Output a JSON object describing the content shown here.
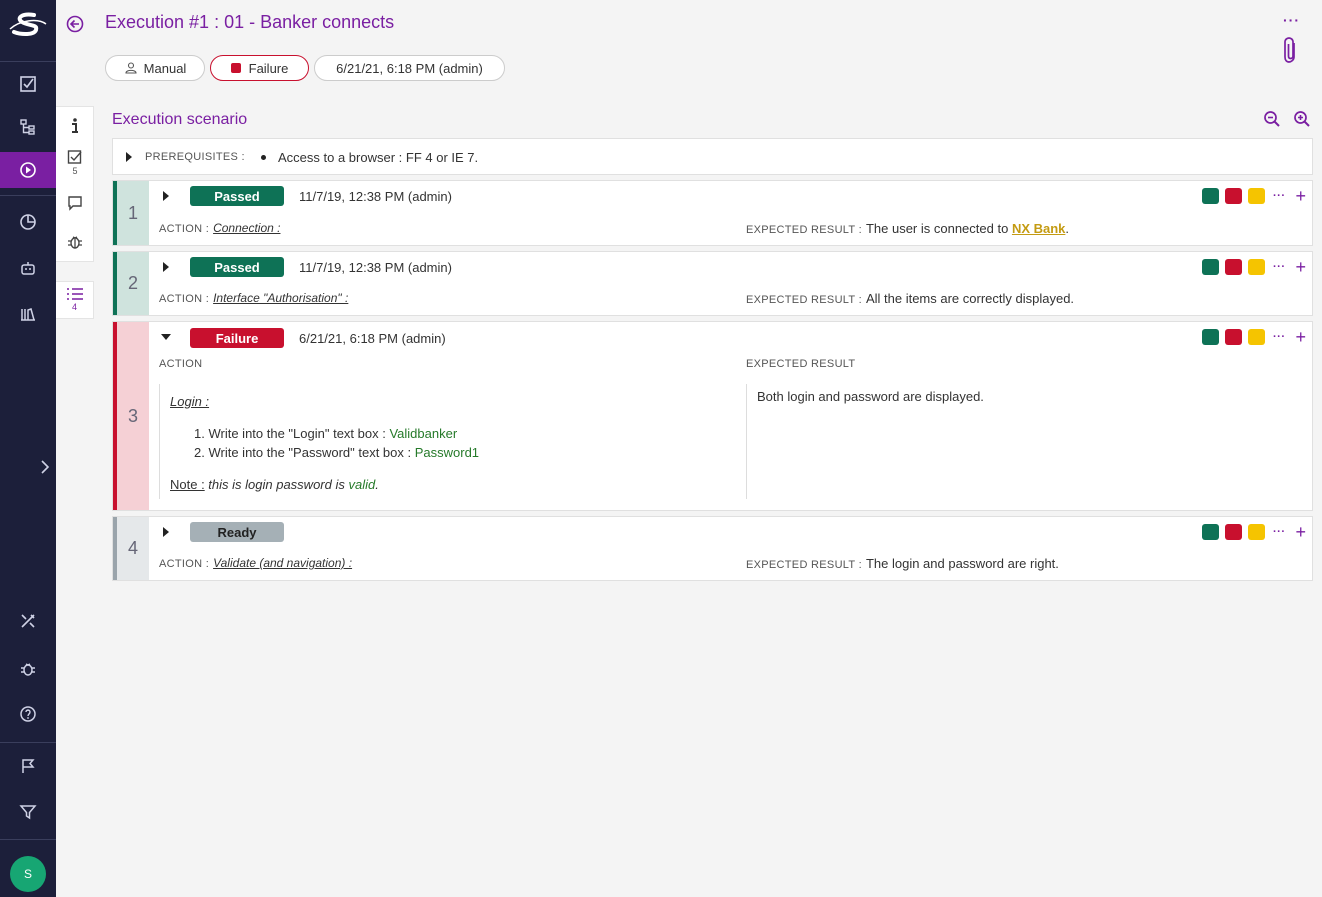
{
  "header": {
    "title": "Execution #1 : 01 - Banker connects",
    "mode_label": "Manual",
    "status_label": "Failure",
    "date_label": "6/21/21, 6:18 PM (admin)",
    "menu_label": "···"
  },
  "side_tabs": {
    "steps_count": "5",
    "list_count": "4"
  },
  "scenario": {
    "title": "Execution scenario",
    "prerequisites_label": "PREREQUISITES :",
    "prerequisite_item": "Access to a browser : FF 4 or IE 7."
  },
  "labels": {
    "action": "ACTION :",
    "expected": "EXPECTED RESULT :",
    "action_header": "ACTION",
    "expected_header": "EXPECTED RESULT",
    "dots": "···",
    "plus": "+"
  },
  "steps": [
    {
      "number": "1",
      "status": "Passed",
      "date": "11/7/19, 12:38 PM (admin)",
      "action": "Connection :",
      "expected_prefix": "The user is connected to ",
      "expected_link": "NX Bank",
      "expected_suffix": "."
    },
    {
      "number": "2",
      "status": "Passed",
      "date": "11/7/19, 12:38 PM (admin)",
      "action": "Interface \"Authorisation\" :",
      "expected": "All the items are correctly displayed."
    },
    {
      "number": "3",
      "status": "Failure",
      "date": "6/21/21, 6:18 PM (admin)",
      "action_title": "Login :",
      "action_line1_prefix": "Write into the \"Login\" text box : ",
      "action_line1_value": "Validbanker",
      "action_line2_prefix": "Write into the \"Password\" text box : ",
      "action_line2_value": "Password1",
      "note_label": "Note :",
      "note_text": " this is login password is ",
      "note_value": "valid",
      "note_end": ".",
      "expected": "Both login and password are displayed."
    },
    {
      "number": "4",
      "status": "Ready",
      "date": "",
      "action": "Validate (and navigation) :",
      "expected": "The login and password are right."
    }
  ],
  "user": {
    "initial": "S"
  },
  "colors": {
    "brand": "#7a1fa2",
    "nav_bg": "#1c1f3a",
    "passed": "#0e7256",
    "failure": "#c8102e",
    "blocked": "#f5c400",
    "ready": "#a5b0b6",
    "avatar": "#17a673"
  }
}
